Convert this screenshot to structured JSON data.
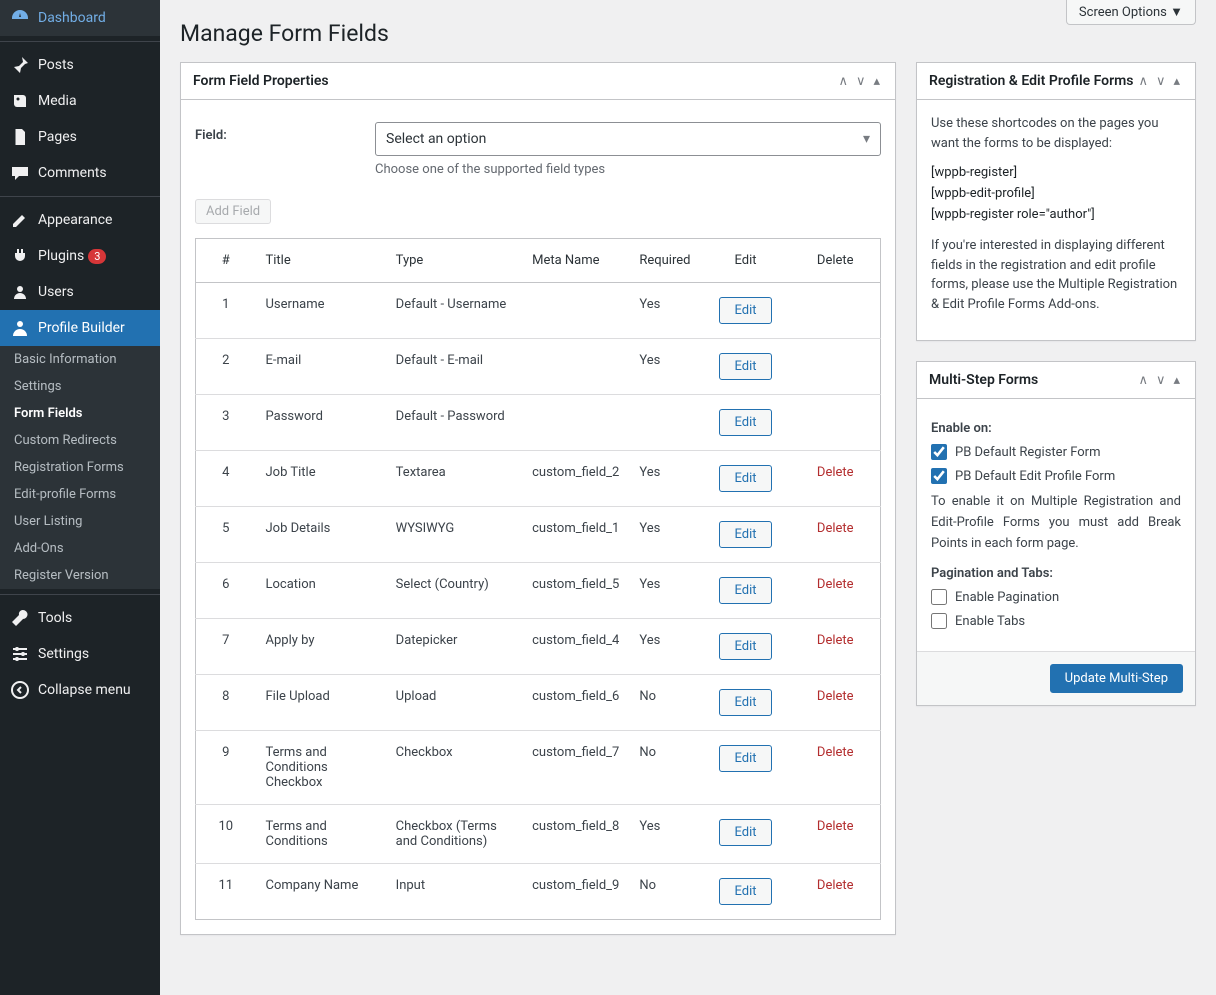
{
  "screenOptions": "Screen Options",
  "sidebar": {
    "items": [
      {
        "icon": "dashboard",
        "label": "Dashboard"
      },
      {
        "icon": "pin",
        "label": "Posts"
      },
      {
        "icon": "media",
        "label": "Media"
      },
      {
        "icon": "page",
        "label": "Pages"
      },
      {
        "icon": "comment",
        "label": "Comments"
      },
      {
        "icon": "appearance",
        "label": "Appearance"
      },
      {
        "icon": "plugin",
        "label": "Plugins",
        "badge": "3"
      },
      {
        "icon": "users",
        "label": "Users"
      },
      {
        "icon": "profile",
        "label": "Profile Builder",
        "active": true
      },
      {
        "icon": "tools",
        "label": "Tools"
      },
      {
        "icon": "settings",
        "label": "Settings"
      },
      {
        "icon": "collapse",
        "label": "Collapse menu"
      }
    ],
    "submenu": [
      "Basic Information",
      "Settings",
      "Form Fields",
      "Custom Redirects",
      "Registration Forms",
      "Edit-profile Forms",
      "User Listing",
      "Add-Ons",
      "Register Version"
    ],
    "submenuCurrent": "Form Fields"
  },
  "pageTitle": "Manage Form Fields",
  "formFieldPanel": {
    "title": "Form Field Properties",
    "fieldLabel": "Field:",
    "selectPlaceholder": "Select an option",
    "helpText": "Choose one of the supported field types",
    "addFieldLabel": "Add Field"
  },
  "table": {
    "headers": {
      "num": "#",
      "title": "Title",
      "type": "Type",
      "meta": "Meta Name",
      "required": "Required",
      "edit": "Edit",
      "delete": "Delete"
    },
    "editLabel": "Edit",
    "deleteLabel": "Delete",
    "rows": [
      {
        "n": "1",
        "title": "Username",
        "type": "Default - Username",
        "meta": "",
        "req": "Yes",
        "del": false
      },
      {
        "n": "2",
        "title": "E-mail",
        "type": "Default - E-mail",
        "meta": "",
        "req": "Yes",
        "del": false
      },
      {
        "n": "3",
        "title": "Password",
        "type": "Default - Password",
        "meta": "",
        "req": "",
        "del": false
      },
      {
        "n": "4",
        "title": "Job Title",
        "type": "Textarea",
        "meta": "custom_field_2",
        "req": "Yes",
        "del": true
      },
      {
        "n": "5",
        "title": "Job Details",
        "type": "WYSIWYG",
        "meta": "custom_field_1",
        "req": "Yes",
        "del": true
      },
      {
        "n": "6",
        "title": "Location",
        "type": "Select (Country)",
        "meta": "custom_field_5",
        "req": "Yes",
        "del": true
      },
      {
        "n": "7",
        "title": "Apply by",
        "type": "Datepicker",
        "meta": "custom_field_4",
        "req": "Yes",
        "del": true
      },
      {
        "n": "8",
        "title": "File Upload",
        "type": "Upload",
        "meta": "custom_field_6",
        "req": "No",
        "del": true
      },
      {
        "n": "9",
        "title": "Terms and Conditions Checkbox",
        "type": "Checkbox",
        "meta": "custom_field_7",
        "req": "No",
        "del": true
      },
      {
        "n": "10",
        "title": "Terms and Conditions",
        "type": "Checkbox (Terms and Conditions)",
        "meta": "custom_field_8",
        "req": "Yes",
        "del": true
      },
      {
        "n": "11",
        "title": "Company Name",
        "type": "Input",
        "meta": "custom_field_9",
        "req": "No",
        "del": true
      }
    ]
  },
  "shortcodesPanel": {
    "title": "Registration & Edit Profile Forms",
    "intro": "Use these shortcodes on the pages you want the forms to be displayed:",
    "codes": [
      "[wppb-register]",
      "[wppb-edit-profile]",
      "[wppb-register role=\"author\"]"
    ],
    "note": "If you're interested in displaying different fields in the registration and edit profile forms, please use the Multiple Registration & Edit Profile Forms Add-ons."
  },
  "multiStepPanel": {
    "title": "Multi-Step Forms",
    "enableOn": "Enable on:",
    "cb1": "PB Default Register Form",
    "cb2": "PB Default Edit Profile Form",
    "note": "To enable it on Multiple Registration and Edit-Profile Forms you must add Break Points in each form page.",
    "pagHeading": "Pagination and Tabs:",
    "cb3": "Enable Pagination",
    "cb4": "Enable Tabs",
    "updateBtn": "Update Multi-Step"
  }
}
